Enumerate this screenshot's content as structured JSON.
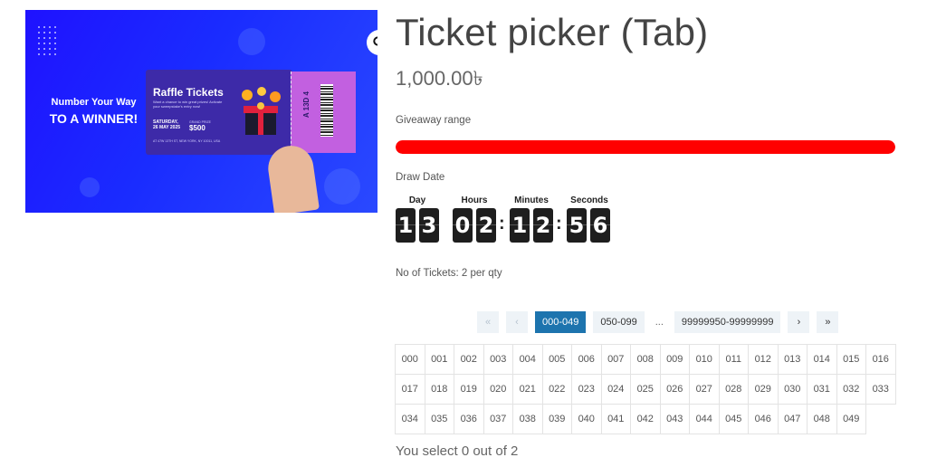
{
  "product_image": {
    "headline_line1": "Number Your Way",
    "headline_line2": "TO A WINNER!",
    "ticket_title": "Raffle Tickets",
    "ticket_subtitle": "Want a chance to win great prizes! Activate your sweepstake's entry now!",
    "ticket_date_label": "SATURDAY,",
    "ticket_date": "26 MAY 2025",
    "ticket_price_label": "GRAND PRIZE",
    "ticket_price": "$500",
    "ticket_address": "AT 47W 13TH ST, NEW YORK, NY 10011, USA",
    "stub_number": "A 13D 4",
    "zoom_icon": "magnifier-icon"
  },
  "product": {
    "title": "Ticket picker (Tab)",
    "price": "1,000.00৳"
  },
  "giveaway": {
    "label": "Giveaway range",
    "progress_fraction": 1.0,
    "bar_color": "#ff0000"
  },
  "draw": {
    "label": "Draw Date",
    "units": [
      {
        "label": "Day",
        "digits": [
          "1",
          "3"
        ]
      },
      {
        "label": "Hours",
        "digits": [
          "0",
          "2"
        ]
      },
      {
        "label": "Minutes",
        "digits": [
          "1",
          "2"
        ]
      },
      {
        "label": "Seconds",
        "digits": [
          "5",
          "6"
        ]
      }
    ]
  },
  "tickets_info": "No of Tickets: 2 per qty",
  "pagination": {
    "first": "«",
    "prev": "‹",
    "pages": [
      "000-049",
      "050-099"
    ],
    "ellipsis": "...",
    "last_page": "99999950-99999999",
    "next": "›",
    "last": "»",
    "active": "000-049",
    "active_color": "#1d74ae"
  },
  "tickets": [
    "000",
    "001",
    "002",
    "003",
    "004",
    "005",
    "006",
    "007",
    "008",
    "009",
    "010",
    "011",
    "012",
    "013",
    "014",
    "015",
    "016",
    "017",
    "018",
    "019",
    "020",
    "021",
    "022",
    "023",
    "024",
    "025",
    "026",
    "027",
    "028",
    "029",
    "030",
    "031",
    "032",
    "033",
    "034",
    "035",
    "036",
    "037",
    "038",
    "039",
    "040",
    "041",
    "042",
    "043",
    "044",
    "045",
    "046",
    "047",
    "048",
    "049"
  ],
  "selection_text": "You select 0 out of 2"
}
